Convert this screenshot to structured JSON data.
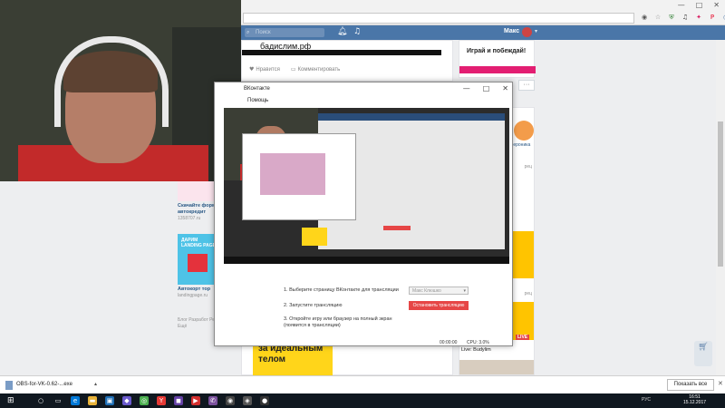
{
  "browser": {
    "window_controls": [
      "—",
      "□",
      "✕"
    ],
    "extensions": [
      {
        "name": "eye-icon",
        "glyph": "◉",
        "color": "#555555"
      },
      {
        "name": "star-icon",
        "glyph": "☆",
        "color": "#888888"
      },
      {
        "name": "shield-icon",
        "glyph": "⛨",
        "color": "#2e7d32"
      },
      {
        "name": "music-icon",
        "glyph": "♫",
        "color": "#333333"
      },
      {
        "name": "bookmark-icon",
        "glyph": "✦",
        "color": "#d81b60"
      },
      {
        "name": "pinterest-icon",
        "glyph": "P",
        "color": "#e60023"
      },
      {
        "name": "globe-icon",
        "glyph": "◎",
        "color": "#4a76a8"
      },
      {
        "name": "menu-icon",
        "glyph": "⋮",
        "color": "#555555"
      }
    ]
  },
  "vk": {
    "search_placeholder": "Поиск",
    "user_name": "Макс"
  },
  "feed": {
    "post_banner_text": "бадислим.рф",
    "like_label": "Нравится",
    "comment_label": "Комментировать",
    "right_ad_heading": "Играй и побеждай!",
    "more_label": "···"
  },
  "left_ads": {
    "ad1_title": "Скачайте форму автокредит",
    "ad1_sub": "1358707.ru",
    "ad2_img_label": "ДАРИМ LANDING PAGE",
    "ad2_title": "Автокорт тор",
    "ad2_sub": "landingpage.ru",
    "footer": "Блог Разработ Реклама Ещё"
  },
  "bottom_ad": {
    "text": "за идеальным телом"
  },
  "right_rail": {
    "name": "Вероника",
    "date1": "рец",
    "date2": "рец",
    "live_badge": "LIVE",
    "live_label": "Live: Budylim"
  },
  "modal": {
    "title": "ВКонтакте",
    "menu": "Помощь",
    "controls": [
      "—",
      "□",
      "✕"
    ],
    "step1": "1. Выберите страницу ВКонтакте для трансляции",
    "step1_value": "Макс Клюшко",
    "step2": "2. Запустите трансляцию",
    "stop_button": "Остановить трансляцию",
    "step3": "3. Откройте игру или браузер на полный экран (появится в трансляции)",
    "status_time": "00:00:00",
    "status_cpu": "CPU: 3.0%"
  },
  "download_bar": {
    "file_name": "OBS-for-VK-0.62-...exe",
    "show_all": "Показать все"
  },
  "taskbar": {
    "tray": "РУС",
    "time": "16:51",
    "date": "15.12.2017",
    "apps": [
      {
        "name": "search-icon",
        "glyph": "○",
        "color": "#101820"
      },
      {
        "name": "task-view-icon",
        "glyph": "▭",
        "color": "#101820"
      },
      {
        "name": "edge-icon",
        "glyph": "e",
        "color": "#0078d7"
      },
      {
        "name": "folder-icon",
        "glyph": "▬",
        "color": "#e8b33a"
      },
      {
        "name": "store-icon",
        "glyph": "▣",
        "color": "#1f6fb5"
      },
      {
        "name": "app-icon",
        "glyph": "◆",
        "color": "#6a5acd"
      },
      {
        "name": "chrome-icon",
        "glyph": "◎",
        "color": "#4caf50"
      },
      {
        "name": "yandex-icon",
        "glyph": "Y",
        "color": "#e53935"
      },
      {
        "name": "twitch-icon",
        "glyph": "◼",
        "color": "#6441a5"
      },
      {
        "name": "video-icon",
        "glyph": "▶",
        "color": "#d32f2f"
      },
      {
        "name": "viber-icon",
        "glyph": "✆",
        "color": "#7b519d"
      },
      {
        "name": "app2-icon",
        "glyph": "◉",
        "color": "#444444"
      },
      {
        "name": "app3-icon",
        "glyph": "◈",
        "color": "#555555"
      },
      {
        "name": "obs-icon",
        "glyph": "●",
        "color": "#333333"
      }
    ]
  }
}
